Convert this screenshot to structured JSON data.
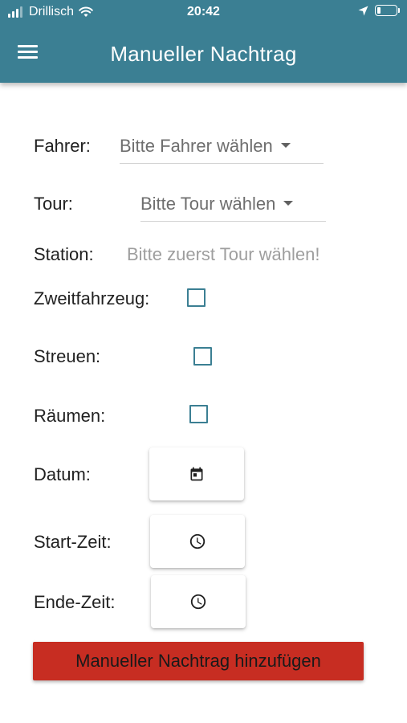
{
  "status_bar": {
    "carrier": "Drillisch",
    "time": "20:42",
    "battery_level": 0.2
  },
  "app_bar": {
    "title": "Manueller Nachtrag",
    "menu_icon": "hamburger-menu-icon"
  },
  "form": {
    "fahrer": {
      "label": "Fahrer:",
      "value": "Bitte Fahrer wählen"
    },
    "tour": {
      "label": "Tour:",
      "value": "Bitte Tour wählen"
    },
    "station": {
      "label": "Station:",
      "hint": "Bitte zuerst Tour wählen!"
    },
    "zweitfahrzeug": {
      "label": "Zweitfahrzeug:",
      "checked": false
    },
    "streuen": {
      "label": "Streuen:",
      "checked": false
    },
    "raeumen": {
      "label": "Räumen:",
      "checked": false
    },
    "datum": {
      "label": "Datum:",
      "icon": "calendar-icon"
    },
    "start_zeit": {
      "label": "Start-Zeit:",
      "icon": "clock-icon"
    },
    "ende_zeit": {
      "label": "Ende-Zeit:",
      "icon": "clock-icon"
    },
    "submit_label": "Manueller Nachtrag hinzufügen"
  },
  "colors": {
    "primary": "#3b7f93",
    "submit": "#c72d22"
  }
}
